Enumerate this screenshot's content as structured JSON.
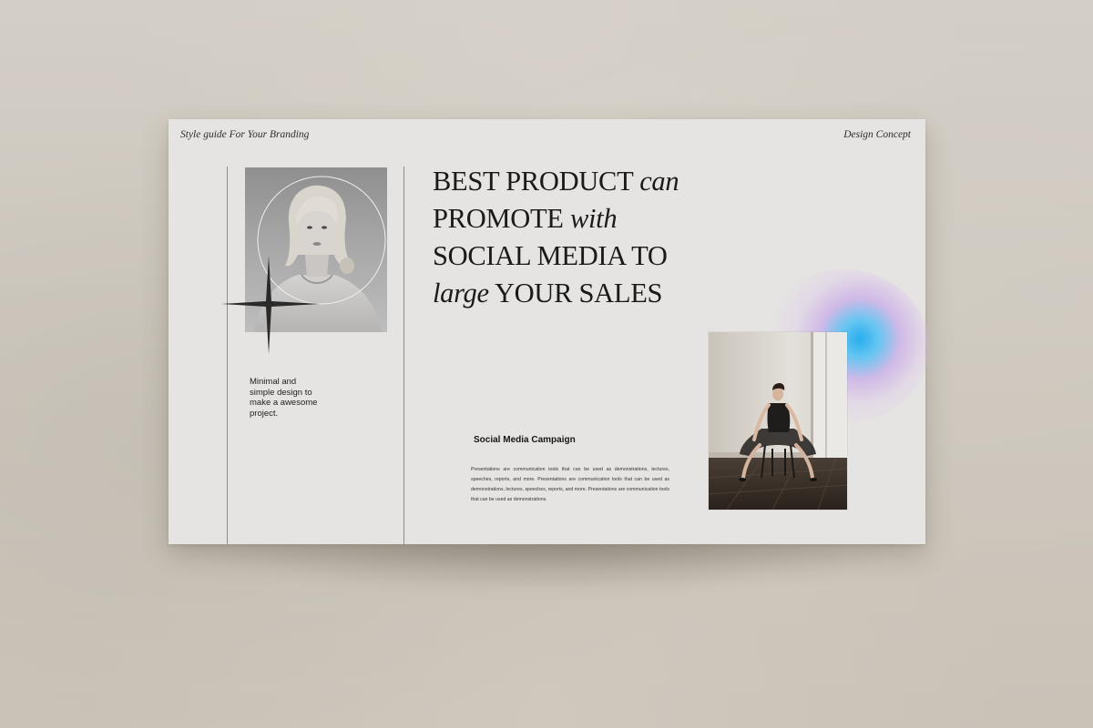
{
  "slide": {
    "header_left": "Style guide For Your Branding",
    "header_right": "Design Concept",
    "headline": {
      "line1_roman": "BEST PRODUCT",
      "line1_italic": "can",
      "line2_roman": "PROMOTE",
      "line2_italic": "with",
      "line3_roman": "SOCIAL MEDIA TO",
      "line4_italic": "large",
      "line4_roman": "YOUR SALES"
    },
    "tagline": "Minimal and simple design to make a awesome project.",
    "campaign": {
      "title": "Social Media Campaign",
      "body": "Presentations are communication tools that can be used as demonstrations, lectures, speeches, reports, and more. Presentations are communication tools that can be used as demonstrations, lectures, speeches, reports, and more. Presentations are communication tools that can be used as demonstrations."
    }
  },
  "colors": {
    "background": "#cdc7bd",
    "slide": "#e5e4e2",
    "text": "#1a1a1a",
    "glow_blue": "#1eaaf0",
    "glow_violet": "#be96eb"
  },
  "icons": [
    "sparkle-star-icon"
  ]
}
